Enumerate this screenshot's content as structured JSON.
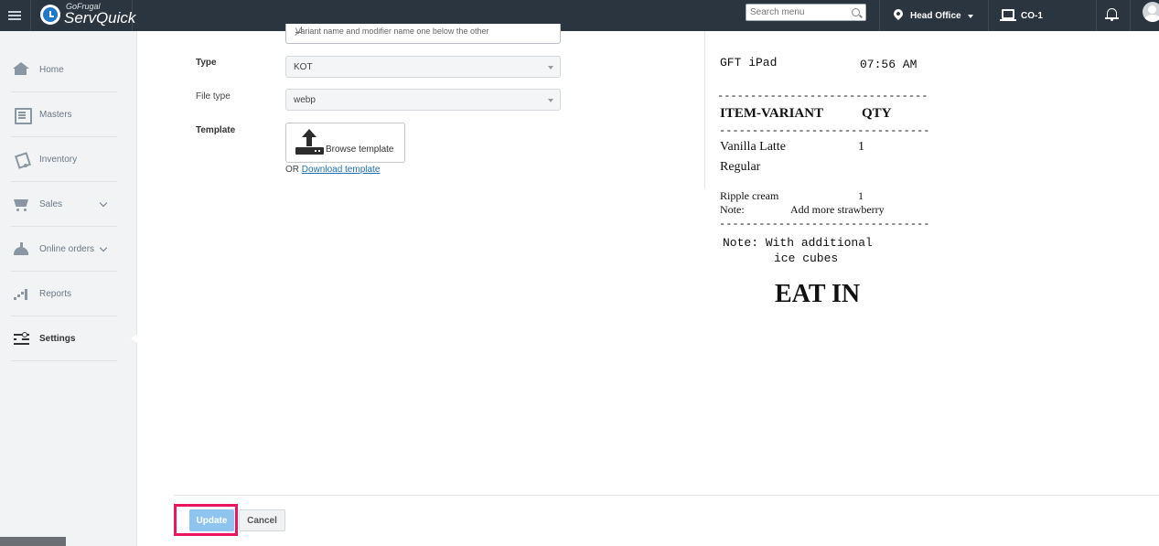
{
  "topbar": {
    "brand_top": "GoFrugal",
    "brand_name": "ServQuick",
    "search_placeholder": "Search menu",
    "location": "Head Office",
    "terminal": "CO-1"
  },
  "sidebar": {
    "items": [
      {
        "label": "Home",
        "icon": "home-icon"
      },
      {
        "label": "Masters",
        "icon": "masters-icon"
      },
      {
        "label": "Inventory",
        "icon": "inventory-icon"
      },
      {
        "label": "Sales",
        "icon": "sales-icon"
      },
      {
        "label": "Online orders",
        "icon": "online-orders-icon"
      },
      {
        "label": "Reports",
        "icon": "reports-icon"
      },
      {
        "label": "Settings",
        "icon": "settings-icon",
        "active": true
      }
    ]
  },
  "form": {
    "textarea_value": "Variant name and modifier name one below the other",
    "type_label": "Type",
    "type_value": "KOT",
    "filetype_label": "File type",
    "filetype_value": "webp",
    "template_label": "Template",
    "browse_label": "Browse template",
    "or_text": "OR",
    "download_link": "Download template"
  },
  "preview": {
    "device": "GFT iPad",
    "time": "07:56 AM",
    "separator": "--------------------------------",
    "col_item": "ITEM-VARIANT",
    "col_qty": "QTY",
    "item1_name": "Vanilla Latte",
    "item1_qty": "1",
    "item1_variant": "Regular",
    "item2_name": "Ripple cream",
    "item2_qty": "1",
    "item2_note_label": "Note:",
    "item2_note": "Add more strawberry",
    "note_line1": "Note: With additional",
    "note_line2": "ice cubes",
    "order_type": "EAT IN"
  },
  "footer": {
    "update_label": "Update",
    "cancel_label": "Cancel"
  },
  "colors": {
    "topbar": "#2b3540",
    "highlight": "#e8175d",
    "update_button": "#8ec4ef",
    "link": "#1f6fb5"
  }
}
